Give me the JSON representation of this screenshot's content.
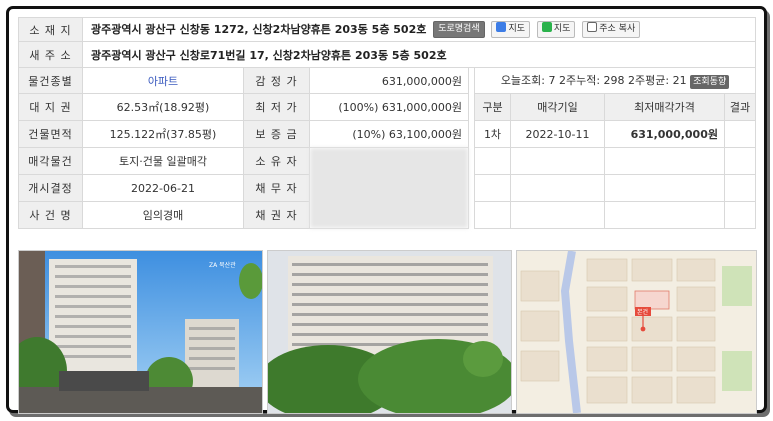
{
  "labels": {
    "location": "소 재 지",
    "new_address": "새 주 소",
    "type": "물건종별",
    "land": "대 지 권",
    "building": "건물면적",
    "sale": "매각물건",
    "start": "개시결정",
    "case": "사 건 명",
    "appraisal": "감 정 가",
    "min_price": "최 저 가",
    "deposit": "보 증 금",
    "owner": "소 유 자",
    "debtor": "채 무 자",
    "creditor": "채 권 자"
  },
  "address": {
    "location": "광주광역시 광산구 신창동 1272, 신창2차남양휴튼 203동 5층 502호",
    "new_address": "광주광역시 광산구 신창로71번길 17, 신창2차남양휴튼 203동 5층 502호",
    "btn_road": "도로명검색",
    "btn_daum": "지도",
    "btn_naver": "지도",
    "btn_copy": "주소 복사"
  },
  "values": {
    "type": "아파트",
    "land": "62.53㎡(18.92평)",
    "building": "125.122㎡(37.85평)",
    "sale": "토지·건물 일괄매각",
    "start": "2022-06-21",
    "case": "임의경매",
    "appraisal": "631,000,000원",
    "min_price": "(100%) 631,000,000원",
    "deposit": "(10%) 63,100,000원"
  },
  "stats": {
    "text": "오늘조회: 7  2주누적: 298  2주평균: 21",
    "chip": "조회동향"
  },
  "history": {
    "headers": [
      "구분",
      "매각기일",
      "최저매각가격",
      "결과"
    ],
    "rows": [
      [
        "1차",
        "2022-10-11",
        "631,000,000원",
        ""
      ]
    ]
  },
  "photos": {
    "p1_sign": "ZA 북산관"
  },
  "map": {
    "marker": "본건"
  }
}
